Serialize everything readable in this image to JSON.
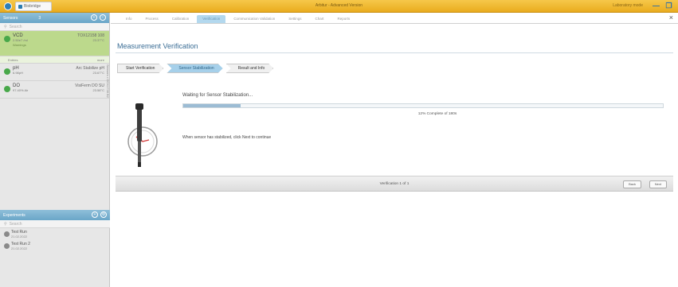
{
  "window": {
    "app_tab_label": "Biobridge",
    "title": "Arbitur - Advanced Version",
    "mode_label": "Laboratory mode",
    "minimize": "—",
    "restore": "❐"
  },
  "sidebar": {
    "sensors_header": "Sensors",
    "sensors_count": "3",
    "search_placeholder": "Search",
    "vertical_label": "Sensors • DOX1738 B2",
    "sensors": [
      {
        "name": "VCD",
        "sub": "2.50e7 /ml",
        "id": "TOX12158 108",
        "id2": "23.37°C",
        "warning": "Warnings",
        "status_color": "#48a84a"
      },
      {
        "name": "pH",
        "sub": "6.98pH",
        "id": "Arc Stabilize pH",
        "id2": "23.67°C",
        "status_color": "#48a84a"
      },
      {
        "name": "DO",
        "sub": "97.40% Air",
        "id": "VisiFerm DO SU",
        "id2": "23.58°C",
        "status_color": "#48a84a"
      }
    ],
    "entries_label": "Entries",
    "entries_more": "more",
    "experiments_header": "Experiments",
    "experiments_search": "Search",
    "experiments": [
      {
        "name": "Test Run",
        "sub": "21.02.2022"
      },
      {
        "name": "Test Run 2",
        "sub": "21.02.2022"
      }
    ]
  },
  "main": {
    "tabs": [
      {
        "label": "Info",
        "active": false
      },
      {
        "label": "Process",
        "active": false
      },
      {
        "label": "Calibration",
        "active": false
      },
      {
        "label": "Verification",
        "active": true
      },
      {
        "label": "Communication Validation",
        "active": false
      },
      {
        "label": "Settings",
        "active": false
      },
      {
        "label": "Chart",
        "active": false
      },
      {
        "label": "Reports",
        "active": false
      }
    ],
    "close_label": "×",
    "page_title": "Measurement Verification",
    "steps": [
      {
        "label": "Start Verification",
        "active": false
      },
      {
        "label": "Sensor Stabilization",
        "active": true
      },
      {
        "label": "Result and Info",
        "active": false
      }
    ],
    "wait_title": "Waiting for Sensor Stabilization...",
    "progress_fraction": 0.12,
    "progress_text": "12% Complete of 180s",
    "stabilize_msg": "When sensor has stabilized, click Next to continue",
    "footer_text": "Verification 1 of 1",
    "back_label": "Back",
    "next_label": "Next"
  },
  "colors": {
    "accent": "#6aa6c8",
    "selected_sensor": "#bcd98c",
    "title_bar": "#e9ab1e"
  },
  "icons": {
    "app": "app-logo-icon",
    "search": "search-icon",
    "sensor_illustration": "sensor-probe-icon"
  }
}
